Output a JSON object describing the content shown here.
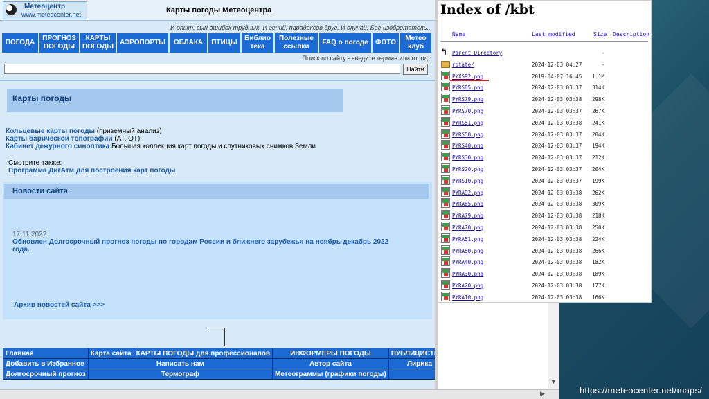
{
  "site": {
    "logo_title": "Метеоцентр",
    "logo_url": "www.meteocenter.net",
    "title": "Карты погоды Метеоцентра",
    "tagline": "И опыт, сын ошибок трудных, И гений, парадоксов друг, И случай, Бог-изобретатель...",
    "nav": [
      {
        "label": "ПОГОДА"
      },
      {
        "label": "ПРОГНОЗ ПОГОДЫ"
      },
      {
        "label": "КАРТЫ ПОГОДЫ"
      },
      {
        "label": "АЭРОПОРТЫ"
      },
      {
        "label": "ОБЛАКА"
      },
      {
        "label": "ПТИЦЫ"
      },
      {
        "label": "Библио тека"
      },
      {
        "label": "Полезные ссылки"
      },
      {
        "label": "FAQ о погоде"
      },
      {
        "label": "ФОТО"
      },
      {
        "label": "Метео клуб"
      }
    ],
    "search_hint": "Поиск по сайту - введите термин или город:",
    "search_button": "Найти",
    "maps_heading": "Карты погоды",
    "lines": [
      {
        "link": "Кольцевые карты погоды",
        "rest": " (приземный анализ)"
      },
      {
        "link": "Карты барической топографии",
        "rest": " (АТ, ОТ)"
      },
      {
        "link": "Кабинет дежурного синоптика",
        "rest": " Большая коллекция карт погоды и спутниковых снимков Земли"
      }
    ],
    "see_also": "Смотрите также:",
    "digatm": "Программа ДигАтм для построения карт погоды",
    "news_title": "Новости сайта",
    "news_date": "17.11.2022",
    "news_text": "Обновлен Долгосрочный прогноз погоды по городам России и ближнего зарубежья на ноябрь-декабрь 2022 года.",
    "news_archive": "Архив новостей сайта >>>",
    "footer": {
      "r1": [
        "Главная",
        "Карта сайта",
        "КАРТЫ ПОГОДЫ для профессионалов",
        "ИНФОРМЕРЫ ПОГОДЫ",
        "ПУБЛИЦИСТИКА"
      ],
      "r2": [
        "Добавить в Избранное",
        "Написать нам",
        "Автор сайта",
        "Лирика"
      ],
      "r3": [
        "Долгосрочный прогноз",
        "Термограф",
        "Метеограммы (графики погоды)"
      ]
    }
  },
  "index": {
    "title": "Index of /kbt",
    "headers": {
      "name": "Name",
      "modified": "Last modified",
      "size": "Size",
      "description": "Description"
    },
    "rows": [
      {
        "icon": "back",
        "name": "Parent Directory",
        "date": "",
        "size": "-"
      },
      {
        "icon": "folder",
        "name": "rotate/",
        "date": "2024-12-03 04:27",
        "size": "-"
      },
      {
        "icon": "image",
        "name": "PYXS92.png",
        "date": "2019-04-07 16:45",
        "size": "1.1M"
      },
      {
        "icon": "image",
        "name": "PYRS85.png",
        "date": "2024-12-03 03:37",
        "size": "314K"
      },
      {
        "icon": "image",
        "name": "PYRS79.png",
        "date": "2024-12-03 03:38",
        "size": "298K"
      },
      {
        "icon": "image",
        "name": "PYRS70.png",
        "date": "2024-12-03 03:37",
        "size": "267K"
      },
      {
        "icon": "image",
        "name": "PYRS51.png",
        "date": "2024-12-03 03:38",
        "size": "241K"
      },
      {
        "icon": "image",
        "name": "PYRS50.png",
        "date": "2024-12-03 03:37",
        "size": "204K"
      },
      {
        "icon": "image",
        "name": "PYRS40.png",
        "date": "2024-12-03 03:37",
        "size": "194K"
      },
      {
        "icon": "image",
        "name": "PYRS30.png",
        "date": "2024-12-03 03:37",
        "size": "212K"
      },
      {
        "icon": "image",
        "name": "PYRS20.png",
        "date": "2024-12-03 03:37",
        "size": "204K"
      },
      {
        "icon": "image",
        "name": "PYRS10.png",
        "date": "2024-12-03 03:37",
        "size": "199K"
      },
      {
        "icon": "image",
        "name": "PYRA92.png",
        "date": "2024-12-03 03:38",
        "size": "262K"
      },
      {
        "icon": "image",
        "name": "PYRA85.png",
        "date": "2024-12-03 03:38",
        "size": "309K"
      },
      {
        "icon": "image",
        "name": "PYRA79.png",
        "date": "2024-12-03 03:38",
        "size": "218K"
      },
      {
        "icon": "image",
        "name": "PYRA70.png",
        "date": "2024-12-03 03:38",
        "size": "250K"
      },
      {
        "icon": "image",
        "name": "PYRA51.png",
        "date": "2024-12-03 03:38",
        "size": "224K"
      },
      {
        "icon": "image",
        "name": "PYRA50.png",
        "date": "2024-12-03 03:38",
        "size": "266K"
      },
      {
        "icon": "image",
        "name": "PYRA40.png",
        "date": "2024-12-03 03:38",
        "size": "182K"
      },
      {
        "icon": "image",
        "name": "PYRA30.png",
        "date": "2024-12-03 03:38",
        "size": "189K"
      },
      {
        "icon": "image",
        "name": "PYRA20.png",
        "date": "2024-12-03 03:38",
        "size": "177K"
      },
      {
        "icon": "image",
        "name": "PYRA10.png",
        "date": "2024-12-03 03:38",
        "size": "166K"
      }
    ]
  },
  "caption": "https://meteocenter.net/maps/"
}
